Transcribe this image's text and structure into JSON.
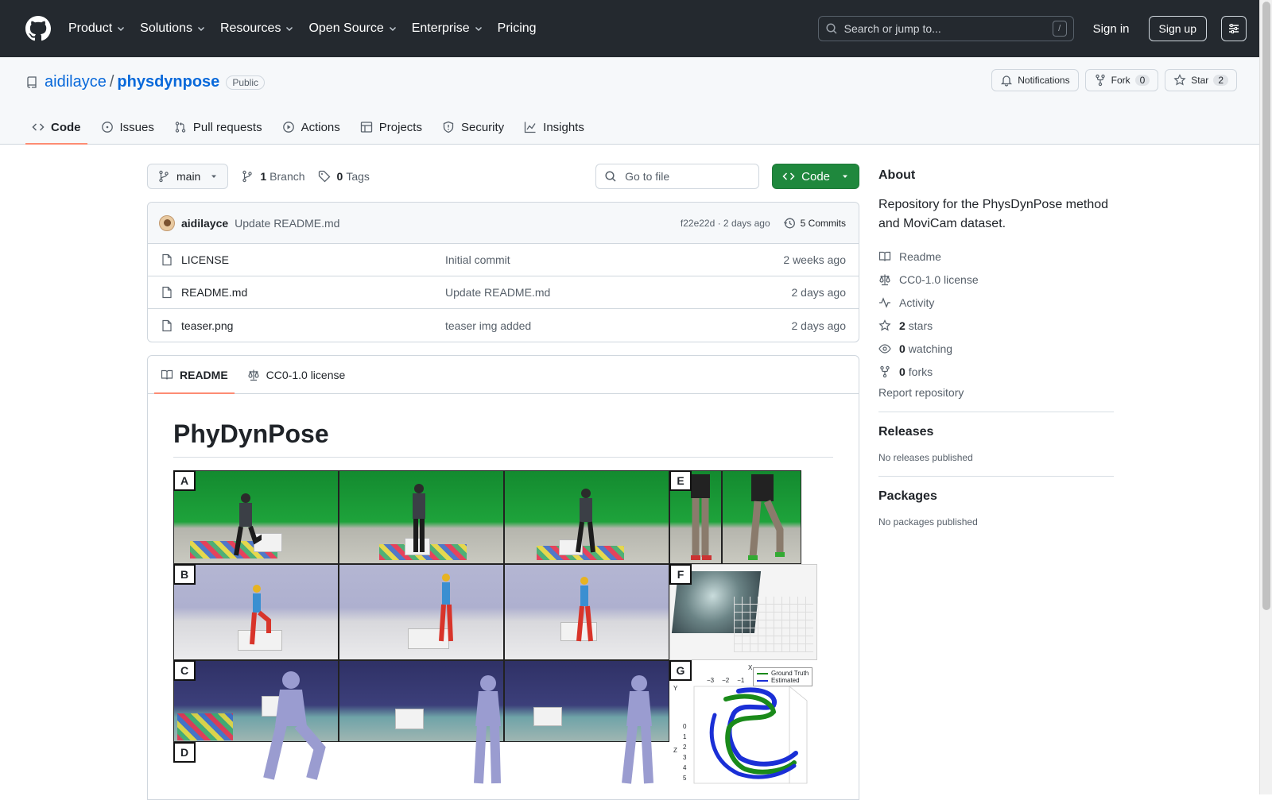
{
  "header": {
    "nav": [
      "Product",
      "Solutions",
      "Resources",
      "Open Source",
      "Enterprise",
      "Pricing"
    ],
    "search_placeholder": "Search or jump to...",
    "search_shortcut": "/",
    "signin": "Sign in",
    "signup": "Sign up"
  },
  "repo": {
    "owner": "aidilayce",
    "separator": "/",
    "name": "physdynpose",
    "visibility": "Public",
    "actions": {
      "notifications": "Notifications",
      "fork": "Fork",
      "fork_count": "0",
      "star": "Star",
      "star_count": "2"
    },
    "tabs": [
      "Code",
      "Issues",
      "Pull requests",
      "Actions",
      "Projects",
      "Security",
      "Insights"
    ]
  },
  "toolbar": {
    "branch": "main",
    "branch_count": "1",
    "branch_label": "Branch",
    "tag_count": "0",
    "tag_label": "Tags",
    "goto_placeholder": "Go to file",
    "code_button": "Code"
  },
  "commit": {
    "author": "aidilayce",
    "message": "Update README.md",
    "meta": "f22e22d · 2 days ago",
    "commits": "5 Commits"
  },
  "files": [
    {
      "name": "LICENSE",
      "message": "Initial commit",
      "date": "2 weeks ago"
    },
    {
      "name": "README.md",
      "message": "Update README.md",
      "date": "2 days ago"
    },
    {
      "name": "teaser.png",
      "message": "teaser img added",
      "date": "2 days ago"
    }
  ],
  "readme": {
    "tabs": [
      "README",
      "CC0-1.0 license"
    ],
    "title": "PhyDynPose",
    "figure": {
      "panel_labels": [
        "A",
        "B",
        "C",
        "D",
        "E",
        "F",
        "G"
      ],
      "legend": [
        "Ground Truth",
        "Estimated"
      ],
      "axis_x_ticks": [
        "−3",
        "−2",
        "−1"
      ],
      "axis_z_ticks": [
        "0",
        "1",
        "2",
        "3",
        "4",
        "5"
      ],
      "axis_x_label": "X",
      "axis_y_label": "Y",
      "axis_z_label": "Z",
      "colors": {
        "ground_truth": "#1a8a1a",
        "estimated": "#1a2fd6"
      }
    }
  },
  "sidebar": {
    "about_title": "About",
    "description": "Repository for the PhysDynPose method and MoviCam dataset.",
    "items": [
      {
        "icon": "book-icon",
        "label": "Readme",
        "count": ""
      },
      {
        "icon": "law-icon",
        "label": "CC0-1.0 license",
        "count": ""
      },
      {
        "icon": "pulse-icon",
        "label": "Activity",
        "count": ""
      },
      {
        "icon": "star-icon",
        "label": "stars",
        "count": "2"
      },
      {
        "icon": "eye-icon",
        "label": "watching",
        "count": "0"
      },
      {
        "icon": "fork-icon",
        "label": "forks",
        "count": "0"
      }
    ],
    "report": "Report repository",
    "releases_title": "Releases",
    "releases_text": "No releases published",
    "packages_title": "Packages",
    "packages_text": "No packages published"
  }
}
